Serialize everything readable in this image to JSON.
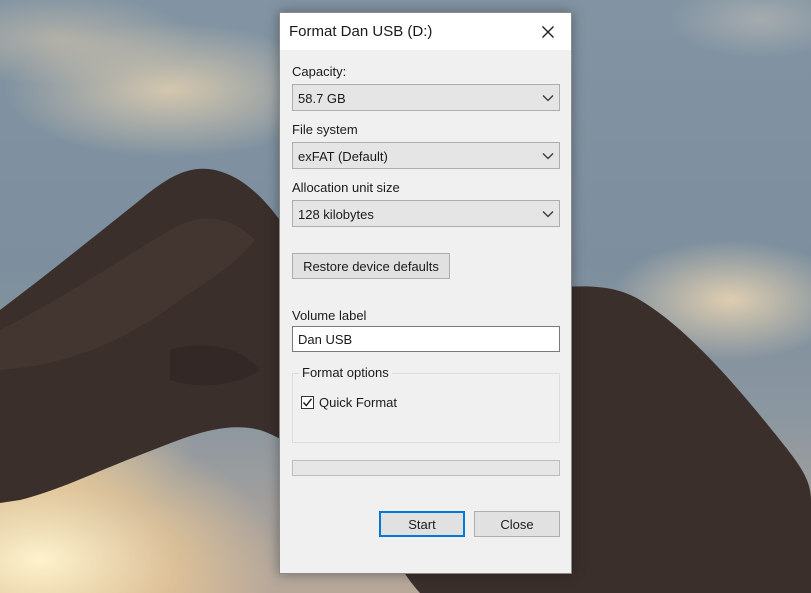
{
  "window": {
    "title": "Format Dan USB (D:)"
  },
  "capacity": {
    "label": "Capacity:",
    "value": "58.7 GB"
  },
  "file_system": {
    "label": "File system",
    "value": "exFAT (Default)"
  },
  "allocation_unit": {
    "label": "Allocation unit size",
    "value": "128 kilobytes"
  },
  "restore_button": {
    "label": "Restore device defaults"
  },
  "volume_label": {
    "label": "Volume label",
    "value": "Dan USB"
  },
  "format_options": {
    "legend": "Format options",
    "quick_format": {
      "label": "Quick Format",
      "checked": true
    }
  },
  "progress": {
    "fraction": 0
  },
  "buttons": {
    "start": "Start",
    "close": "Close"
  },
  "colors": {
    "accent": "#0078d7",
    "dialog_bg": "#f0f0f0",
    "titlebar_bg": "#ffffff"
  }
}
